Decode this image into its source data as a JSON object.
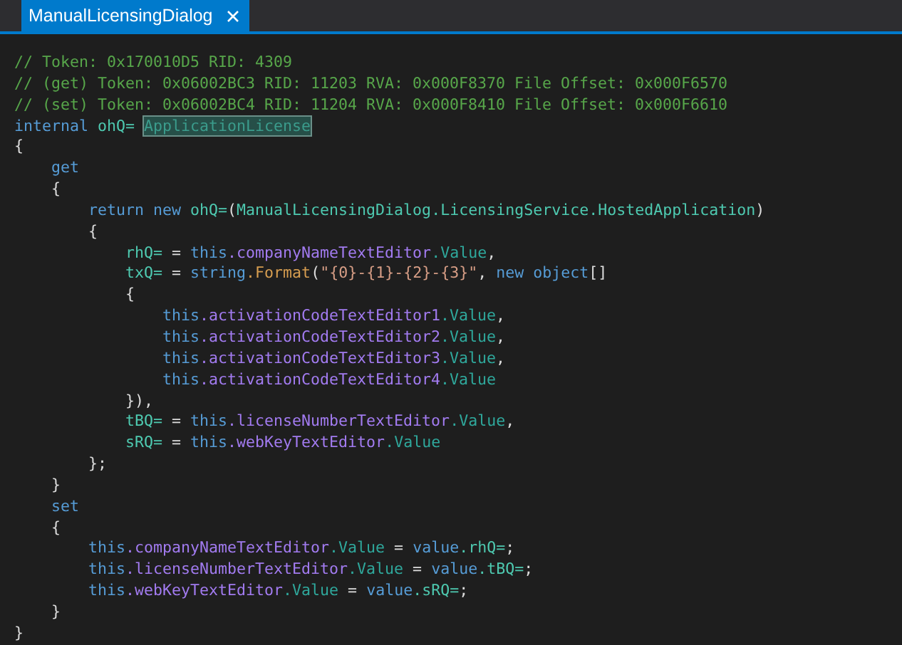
{
  "tabs": [
    {
      "label": "ManualLicensingDialog",
      "selected": true
    }
  ],
  "code_lines": [
    {
      "tokens": [
        {
          "kind": "comment",
          "text": "// Token: 0x170010D5 RID: 4309"
        }
      ]
    },
    {
      "tokens": [
        {
          "kind": "comment",
          "text": "// (get) Token: 0x06002BC3 RID: 11203 RVA: 0x000F8370 File Offset: 0x000F6570"
        }
      ]
    },
    {
      "tokens": [
        {
          "kind": "comment",
          "text": "// (set) Token: 0x06002BC4 RID: 11204 RVA: 0x000F8410 File Offset: 0x000F6610"
        }
      ]
    },
    {
      "tokens": [
        {
          "kind": "keyword",
          "text": "internal "
        },
        {
          "kind": "type",
          "text": "ohQ= "
        },
        {
          "kind": "selected",
          "text": "ApplicationLicense"
        }
      ]
    },
    {
      "tokens": [
        {
          "kind": "plain",
          "text": "{"
        }
      ]
    },
    {
      "tokens": [
        {
          "kind": "keyword",
          "text": "    get"
        }
      ]
    },
    {
      "tokens": [
        {
          "kind": "plain",
          "text": "    {"
        }
      ]
    },
    {
      "tokens": [
        {
          "kind": "keyword",
          "text": "        return new "
        },
        {
          "kind": "type",
          "text": "ohQ="
        },
        {
          "kind": "plain",
          "text": "("
        },
        {
          "kind": "type",
          "text": "ManualLicensingDialog"
        },
        {
          "kind": "type",
          "text": ".LicensingService"
        },
        {
          "kind": "type",
          "text": ".HostedApplication"
        },
        {
          "kind": "plain",
          "text": ")"
        }
      ]
    },
    {
      "tokens": [
        {
          "kind": "plain",
          "text": "        {"
        }
      ]
    },
    {
      "tokens": [
        {
          "kind": "type",
          "text": "            rhQ="
        },
        {
          "kind": "plain",
          "text": " = "
        },
        {
          "kind": "keyword",
          "text": "this"
        },
        {
          "kind": "member",
          "text": ".companyNameTextEditor"
        },
        {
          "kind": "field",
          "text": ".Value"
        },
        {
          "kind": "plain",
          "text": ","
        }
      ]
    },
    {
      "tokens": [
        {
          "kind": "type",
          "text": "            txQ="
        },
        {
          "kind": "plain",
          "text": " = "
        },
        {
          "kind": "keyword",
          "text": "string"
        },
        {
          "kind": "method",
          "text": ".Format"
        },
        {
          "kind": "plain",
          "text": "("
        },
        {
          "kind": "string",
          "text": "\"{0}-{1}-{2}-{3}\""
        },
        {
          "kind": "plain",
          "text": ", "
        },
        {
          "kind": "keyword",
          "text": "new object"
        },
        {
          "kind": "plain",
          "text": "[]"
        }
      ]
    },
    {
      "tokens": [
        {
          "kind": "plain",
          "text": "            {"
        }
      ]
    },
    {
      "tokens": [
        {
          "kind": "keyword",
          "text": "                this"
        },
        {
          "kind": "member",
          "text": ".activationCodeTextEditor1"
        },
        {
          "kind": "field",
          "text": ".Value"
        },
        {
          "kind": "plain",
          "text": ","
        }
      ]
    },
    {
      "tokens": [
        {
          "kind": "keyword",
          "text": "                this"
        },
        {
          "kind": "member",
          "text": ".activationCodeTextEditor2"
        },
        {
          "kind": "field",
          "text": ".Value"
        },
        {
          "kind": "plain",
          "text": ","
        }
      ]
    },
    {
      "tokens": [
        {
          "kind": "keyword",
          "text": "                this"
        },
        {
          "kind": "member",
          "text": ".activationCodeTextEditor3"
        },
        {
          "kind": "field",
          "text": ".Value"
        },
        {
          "kind": "plain",
          "text": ","
        }
      ]
    },
    {
      "tokens": [
        {
          "kind": "keyword",
          "text": "                this"
        },
        {
          "kind": "member",
          "text": ".activationCodeTextEditor4"
        },
        {
          "kind": "field",
          "text": ".Value"
        }
      ]
    },
    {
      "tokens": [
        {
          "kind": "plain",
          "text": "            }),"
        }
      ]
    },
    {
      "tokens": [
        {
          "kind": "type",
          "text": "            tBQ="
        },
        {
          "kind": "plain",
          "text": " = "
        },
        {
          "kind": "keyword",
          "text": "this"
        },
        {
          "kind": "member",
          "text": ".licenseNumberTextEditor"
        },
        {
          "kind": "field",
          "text": ".Value"
        },
        {
          "kind": "plain",
          "text": ","
        }
      ]
    },
    {
      "tokens": [
        {
          "kind": "type",
          "text": "            sRQ="
        },
        {
          "kind": "plain",
          "text": " = "
        },
        {
          "kind": "keyword",
          "text": "this"
        },
        {
          "kind": "member",
          "text": ".webKeyTextEditor"
        },
        {
          "kind": "field",
          "text": ".Value"
        }
      ]
    },
    {
      "tokens": [
        {
          "kind": "plain",
          "text": "        };"
        }
      ]
    },
    {
      "tokens": [
        {
          "kind": "plain",
          "text": "    }"
        }
      ]
    },
    {
      "tokens": [
        {
          "kind": "keyword",
          "text": "    set"
        }
      ]
    },
    {
      "tokens": [
        {
          "kind": "plain",
          "text": "    {"
        }
      ]
    },
    {
      "tokens": [
        {
          "kind": "keyword",
          "text": "        this"
        },
        {
          "kind": "member",
          "text": ".companyNameTextEditor"
        },
        {
          "kind": "field",
          "text": ".Value"
        },
        {
          "kind": "plain",
          "text": " = "
        },
        {
          "kind": "keyword",
          "text": "value"
        },
        {
          "kind": "type",
          "text": ".rhQ="
        },
        {
          "kind": "plain",
          "text": ";"
        }
      ]
    },
    {
      "tokens": [
        {
          "kind": "keyword",
          "text": "        this"
        },
        {
          "kind": "member",
          "text": ".licenseNumberTextEditor"
        },
        {
          "kind": "field",
          "text": ".Value"
        },
        {
          "kind": "plain",
          "text": " = "
        },
        {
          "kind": "keyword",
          "text": "value"
        },
        {
          "kind": "type",
          "text": ".tBQ="
        },
        {
          "kind": "plain",
          "text": ";"
        }
      ]
    },
    {
      "tokens": [
        {
          "kind": "keyword",
          "text": "        this"
        },
        {
          "kind": "member",
          "text": ".webKeyTextEditor"
        },
        {
          "kind": "field",
          "text": ".Value"
        },
        {
          "kind": "plain",
          "text": " = "
        },
        {
          "kind": "keyword",
          "text": "value"
        },
        {
          "kind": "type",
          "text": ".sRQ="
        },
        {
          "kind": "plain",
          "text": ";"
        }
      ]
    },
    {
      "tokens": [
        {
          "kind": "plain",
          "text": "    }"
        }
      ]
    },
    {
      "tokens": [
        {
          "kind": "plain",
          "text": "}"
        }
      ]
    }
  ]
}
